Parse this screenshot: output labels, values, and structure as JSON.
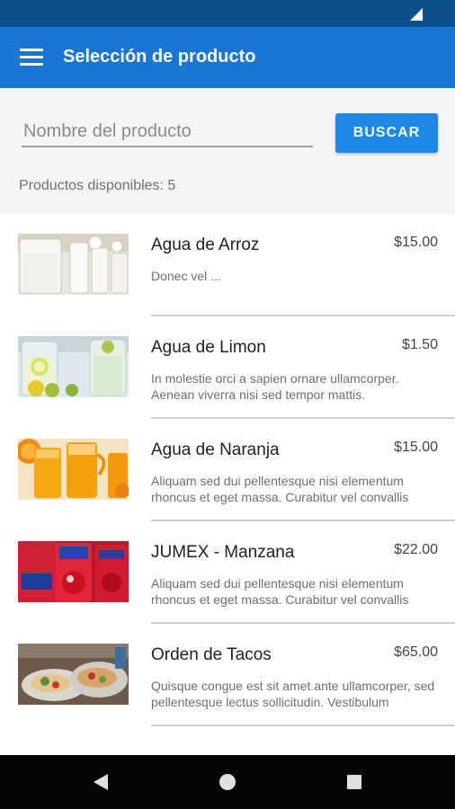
{
  "app": {
    "title": "Selección de producto"
  },
  "search": {
    "placeholder": "Nombre del producto",
    "value": "",
    "button_label": "BUSCAR"
  },
  "products_count_label": "Productos disponibles: 5",
  "products": [
    {
      "name": "Agua de Arroz",
      "price": "$15.00",
      "description": "Donec vel ...",
      "image_icon": "rice-water-drink-image"
    },
    {
      "name": "Agua de Limon",
      "price": "$1.50",
      "description": "In molestie orci a sapien ornare ullamcorper. Aenean viverra nisi sed tempor mattis.",
      "image_icon": "lemon-water-drink-image"
    },
    {
      "name": "Agua de Naranja",
      "price": "$15.00",
      "description": "Aliquam sed dui pellentesque nisi elementum rhoncus et eget massa. Curabitur vel convallis",
      "image_icon": "orange-juice-image"
    },
    {
      "name": "JUMEX - Manzana",
      "price": "$22.00",
      "description": "Aliquam sed dui pellentesque nisi elementum rhoncus et eget massa. Curabitur vel convallis",
      "image_icon": "jumex-apple-can-image"
    },
    {
      "name": "Orden de Tacos",
      "price": "$65.00",
      "description": "Quisque congue est sit amet ante ullamcorper, sed pellentesque lectus sollicitudin. Vestibulum",
      "image_icon": "tacos-plate-image"
    }
  ],
  "theme": {
    "status_bar": "#0d4f8b",
    "app_bar": "#1976d2",
    "accent_button": "#1e88e5",
    "nav_bar": "#050505"
  }
}
